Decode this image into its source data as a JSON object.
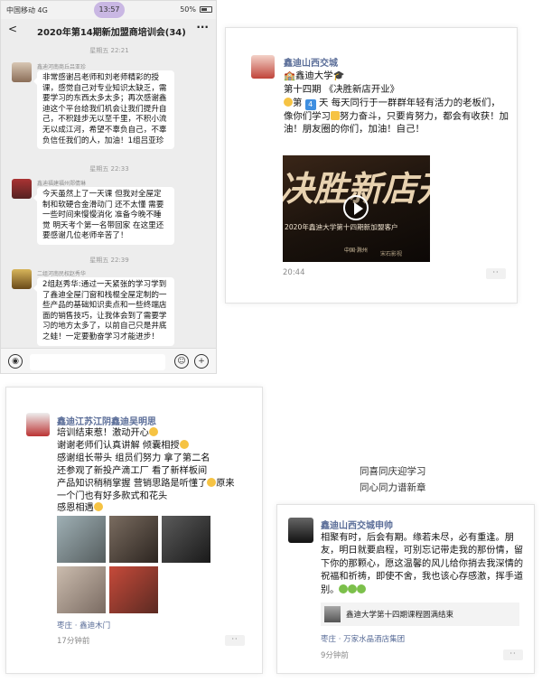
{
  "chat": {
    "status_left": "中国移动 4G",
    "status_time": "13:57",
    "status_right": "50%",
    "back_label": "<",
    "title": "2020年第14期新加盟商培训会(34)",
    "more_label": "···",
    "messages": [
      {
        "time": "星期五 22:21",
        "sender": "鑫迪河南商丘吕亚珍",
        "text": "非常感谢吕老师和刘老师精彩的授课，感觉自己对专业知识太缺乏，需要学习的东西太多太多；再次感谢鑫迪这个平台给我们机会让我们提升自己，不积跬步无以至千里，不积小流无以成江河，希望不辜负自己，不辜负信任我们的人，加油！1组吕亚珍"
      },
      {
        "time": "星期五 22:33",
        "sender": "鑫迪福建福州郑倩琳",
        "text": "今天虽然上了一天课 但我对全屋定制和软硬合金滑动门 还不太懂 需要一些时间来慢慢消化 准备今晚不睡觉 明天考个第一名带回家 在这里还要感谢几位老师辛苦了！"
      },
      {
        "time": "星期五 22:39",
        "sender": "二组河南民权赵秀华",
        "text": "2组赵秀华:通过一天紧张的学习学到了鑫迪全屋门窗和栈棍全屋定制的一些产品的基础知识卖点和一些终端店面的销售技巧，让我体会到了需要学习的地方太多了，以前自己只是井底之蛙！一定要勤奋学习才能进步！"
      }
    ]
  },
  "card_top": {
    "user": "鑫迪山西交城",
    "line1": "鑫迪大学",
    "line2": "第十四期 《决胜新店开业》",
    "line3_pre": "第",
    "day_num": "4",
    "line3_post": "天  每天同行于一群群年轻有活力的老板们，像你们学习",
    "line3_tail": "努力奋斗，只要肯努力，都会有收获！加油！朋友圈的你们，加油！自己！",
    "video_big": "决胜新店开",
    "video_sub": "2020年鑫迪大学第十四期新加盟客户",
    "video_city": "中国·滁州",
    "video_wm": "宋石影视",
    "time": "20:44",
    "dots": "··"
  },
  "card_bottom_left": {
    "user": "鑫迪江苏江阴鑫迪吴明思",
    "text_a": "培训结束惹！激动开心",
    "text_b": "谢谢老师们认真讲解 倾囊相授",
    "text_c": "感谢组长带头 组员们努力 拿了第二名",
    "text_d": "还参观了新投产滴工厂 看了新样板间",
    "text_e": "产品知识稍稍掌握 营销思路是听懂了",
    "text_e2": "原来",
    "text_f": "一个门也有好多款式和花头",
    "text_g": "感恩相遇",
    "location": "枣庄 · 鑫迪木门",
    "time": "17分钟前",
    "dots": "··"
  },
  "slogan": {
    "line1": "同喜同庆迎学习",
    "line2": "同心同力谱新章"
  },
  "card_bottom_right": {
    "user": "鑫迪山西交城申帅",
    "text": "相聚有时，后会有期。缘若未尽，必有重逢。朋友，明日就要启程，可别忘记带走我的那份情，留下你的那颗心，愿这温馨的风儿给你捎去我深情的祝福和祈祷，即使不舍，我也该心存感激，挥手道别。",
    "link_text": "鑫迪大学第十四期课程圆满结束",
    "location": "枣庄 · 万家水晶酒店集团",
    "time": "9分钟前",
    "dots": "··"
  },
  "colors": {
    "link_blue": "#5a6d98",
    "chat_bg": "#ededed",
    "time_pill": "#c9b7e3"
  }
}
